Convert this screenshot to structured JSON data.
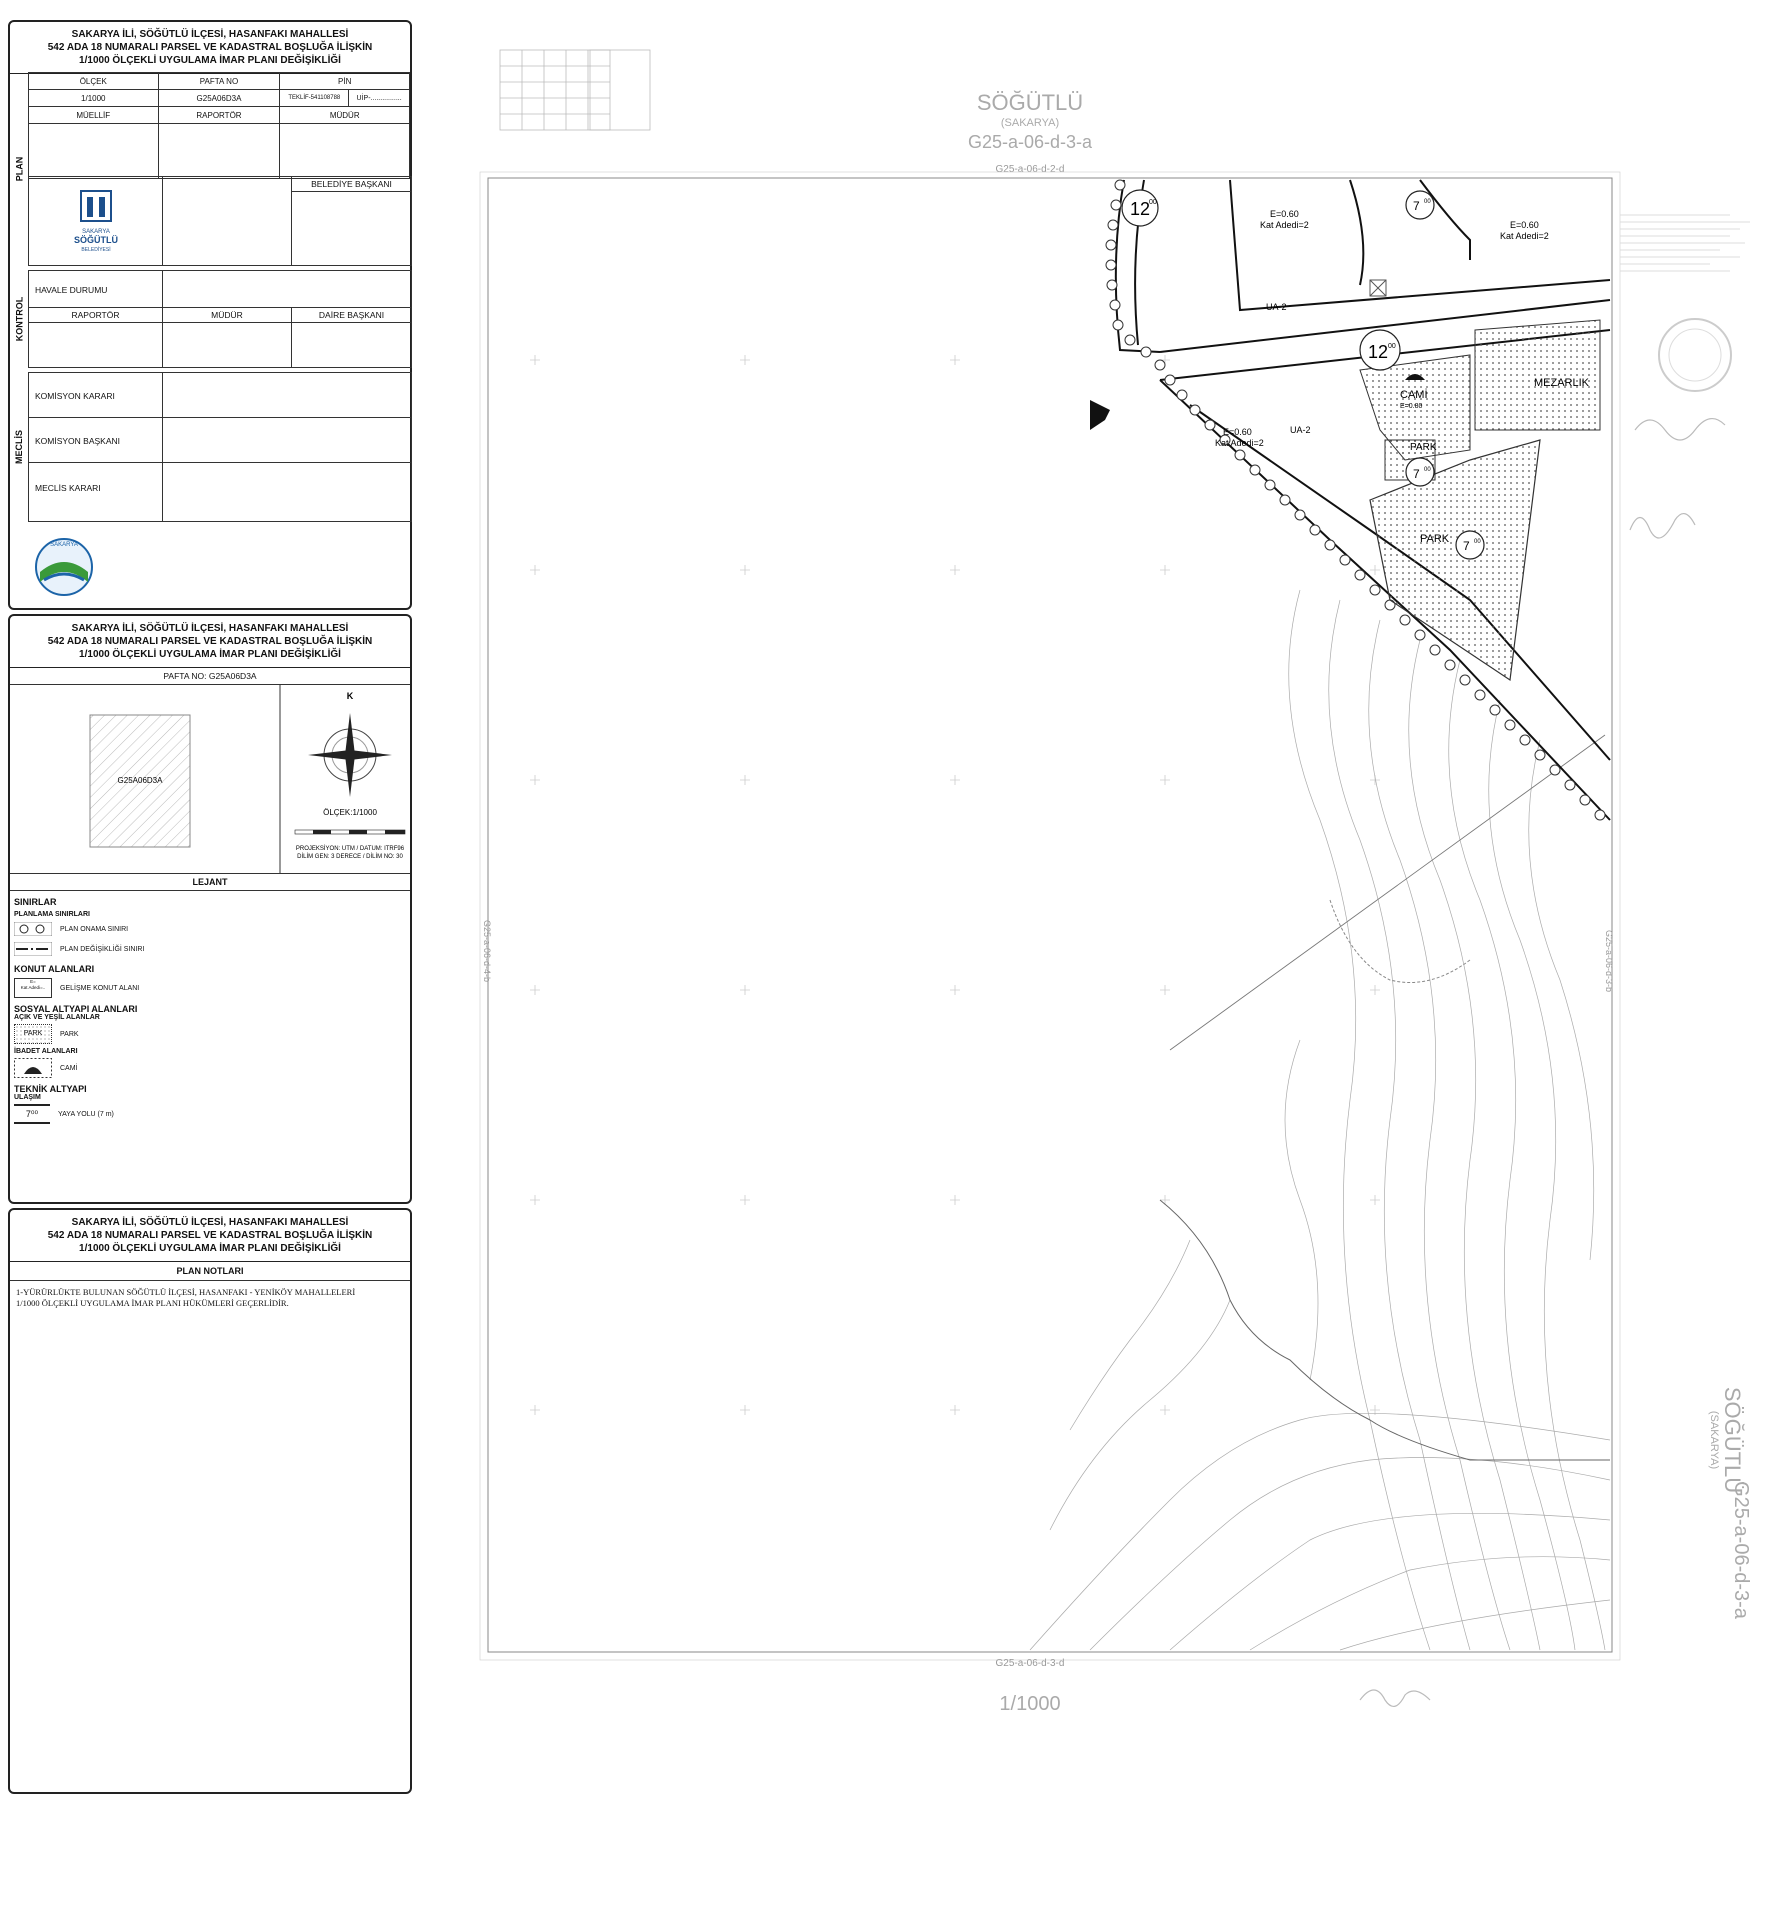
{
  "panel1": {
    "title_lines": [
      "SAKARYA İLİ, SÖĞÜTLÜ İLÇESİ, HASANFAKI MAHALLESİ",
      "542 ADA 18 NUMARALI PARSEL VE KADASTRAL BOŞLUĞA İLİŞKİN",
      "1/1000 ÖLÇEKLİ UYGULAMA İMAR PLANI DEĞİŞİKLİĞİ"
    ],
    "plan_label": "PLAN",
    "headers": {
      "olcek": "ÖLÇEK",
      "pafta": "PAFTA NO",
      "pin": "PİN"
    },
    "values": {
      "olcek": "1/1000",
      "pafta": "G25A06D3A",
      "teklif": "TEKLİF-541108788",
      "uip": "UİP-................"
    },
    "roles": {
      "muellif": "MÜELLİF",
      "raportor": "RAPORTÖR",
      "mudur": "MÜDÜR"
    },
    "belediye_baskani": "BELEDİYE BAŞKANI",
    "logo_text": [
      "SAKARYA",
      "SÖĞÜTLÜ",
      "BELEDİYESİ"
    ],
    "kontrol_label": "KONTROL",
    "havale": "HAVALE DURUMU",
    "kontrol_roles": {
      "raportor": "RAPORTÖR",
      "mudur": "MÜDÜR",
      "daire": "DAİRE BAŞKANI"
    },
    "meclis_label": "MECLİS",
    "komisyon_karari": "KOMİSYON KARARI",
    "komisyon_baskani": "KOMİSYON BAŞKANI",
    "meclis_karari": "MECLİS KARARI",
    "sakarya_logo": "SAKARYA"
  },
  "panel2": {
    "title_lines": [
      "SAKARYA İLİ, SÖĞÜTLÜ İLÇESİ, HASANFAKI MAHALLESİ",
      "542 ADA 18 NUMARALI PARSEL VE KADASTRAL BOŞLUĞA İLİŞKİN",
      "1/1000 ÖLÇEKLİ UYGULAMA İMAR PLANI DEĞİŞİKLİĞİ"
    ],
    "pafta_no": "PAFTA NO: G25A06D3A",
    "sheet_label": "G25A06D3A",
    "north": "K",
    "scale": "ÖLÇEK:1/1000",
    "projection": [
      "PROJEKSİYON: UTM / DATUM: ITRF96",
      "DİLİM GEN: 3 DERECE / DİLİM NO: 30"
    ],
    "lejant": "LEJANT",
    "legend": {
      "sinirlar": "SINIRLAR",
      "planlama": "PLANLAMA SINIRLARI",
      "onama": "PLAN ONAMA SINIRI",
      "degisiklik": "PLAN DEĞİŞİKLİĞİ SINIRI",
      "konut": "KONUT ALANLARI",
      "gelisme": "GELİŞME KONUT ALANI",
      "gelisme_sym": [
        "E=",
        "Kat Adedi=.."
      ],
      "sosyal": "SOSYAL ALTYAPI ALANLARI",
      "acik": "AÇIK VE YEŞİL ALANLAR",
      "park": "PARK",
      "park_sym": "PARK",
      "ibadet": "İBADET ALANLARI",
      "cami": "CAMİ",
      "teknik": "TEKNİK ALTYAPI",
      "ulasim": "ULAŞIM",
      "yaya": "YAYA YOLU (7 m)",
      "yaya_sym": "7⁰⁰"
    }
  },
  "panel3": {
    "title_lines": [
      "SAKARYA İLİ, SÖĞÜTLÜ İLÇESİ, HASANFAKI MAHALLESİ",
      "542 ADA 18 NUMARALI PARSEL VE KADASTRAL BOŞLUĞA İLİŞKİN",
      "1/1000 ÖLÇEKLİ UYGULAMA İMAR PLANI DEĞİŞİKLİĞİ"
    ],
    "notes_title": "PLAN NOTLARI",
    "notes": [
      "1-YÜRÜRLÜKTE BULUNAN SÖĞÜTLÜ İLÇESİ, HASANFAKI - YENİKÖY MAHALLELERİ",
      "1/1000 ÖLÇEKLİ UYGULAMA İMAR PLANI HÜKÜMLERİ GEÇERLİDİR."
    ]
  },
  "map": {
    "city": "SÖĞÜTLÜ",
    "province": "(SAKARYA)",
    "sheet": "G25-a-06-d-3-a",
    "top_sheet": "G25-a-06-d-2-d",
    "bottom_sheet": "G25-a-06-d-3-d",
    "left_sheet": "G25-a-06-d-4-b",
    "right_sheet": "G25-a-06-d-3-b",
    "scale": "1/1000",
    "labels": {
      "e1": "E=0.60",
      "k1": "Kat Adedi=2",
      "e2": "E=0.60",
      "k2": "Kat Adedi=2",
      "e3": "E=0.60",
      "k3": "Kat Adedi=2",
      "ua1": "UA-2",
      "ua2": "UA-2",
      "cami": "CAMİ",
      "cami_e": "E=0.80",
      "mezarlik": "MEZARLIK",
      "park1": "PARK",
      "park2": "PARK",
      "road12a": "12",
      "road12b": "12",
      "sup": "00",
      "road7a": "7",
      "road7b": "7",
      "road7c": "7"
    }
  }
}
